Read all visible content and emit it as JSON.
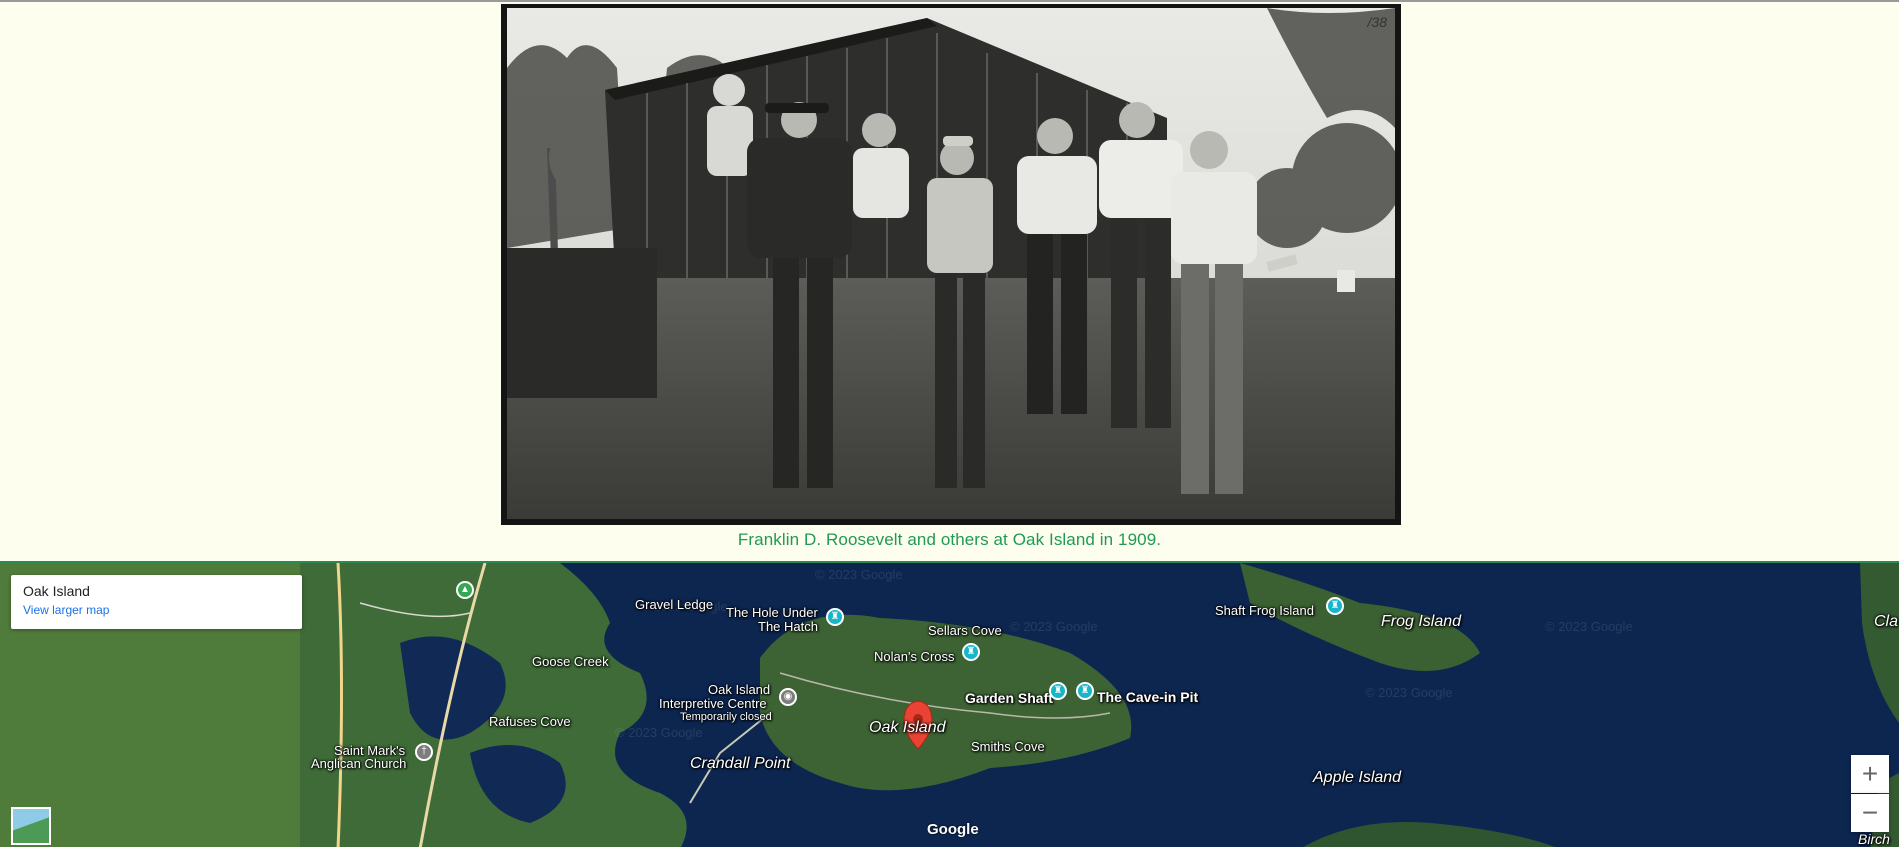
{
  "photo": {
    "description_icon": "photograph",
    "corner_mark": "/38"
  },
  "caption": "Franklin D. Roosevelt and others at Oak Island in 1909.",
  "map": {
    "card_title": "Oak Island",
    "card_link": "View larger map",
    "watermark": "© 2023 Google",
    "brand": "Google",
    "zoom_in": "+",
    "zoom_out": "−",
    "labels": {
      "gravel_ledge": "Gravel Ledge",
      "hole_under_1": "The Hole Under",
      "hole_under_2": "The Hatch",
      "sellars_cove": "Sellars Cove",
      "shaft_frog": "Shaft Frog Island",
      "frog_island": "Frog Island",
      "goose_creek": "Goose Creek",
      "nolans_cross": "Nolan's Cross",
      "interp_1": "Oak Island",
      "interp_2": "Interpretive Centre",
      "interp_3": "Temporarily closed",
      "garden_shaft": "Garden Shaft",
      "cave_pit": "The Cave-in Pit",
      "rafuses_cove": "Rafuses Cove",
      "oak_island": "Oak Island",
      "smiths_cove": "Smiths Cove",
      "saint_marks_1": "Saint Mark's",
      "saint_marks_2": "Anglican Church",
      "crandall_point": "Crandall Point",
      "apple_island": "Apple Island",
      "cla": "Cla",
      "birch": "Birch"
    }
  }
}
